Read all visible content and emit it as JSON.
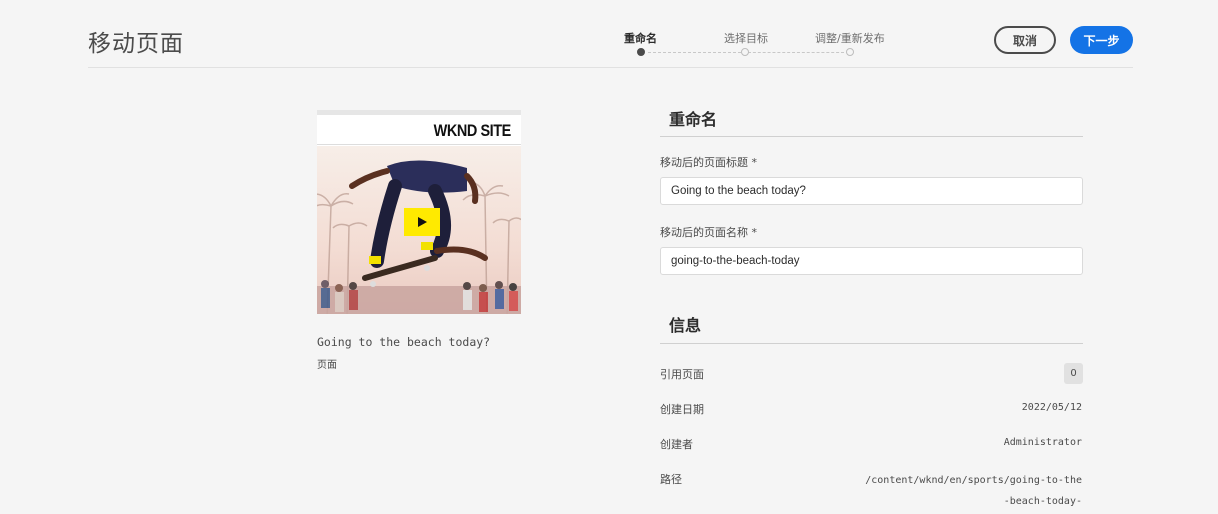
{
  "header": {
    "title": "移动页面",
    "steps": [
      {
        "label": "重命名",
        "active": true
      },
      {
        "label": "选择目标",
        "active": false
      },
      {
        "label": "调整/重新发布",
        "active": false
      }
    ],
    "cancel_label": "取消",
    "next_label": "下一步"
  },
  "card": {
    "logo_text": "WKND SITE",
    "title": "Going to the beach today?",
    "type": "页面"
  },
  "rename": {
    "heading": "重命名",
    "title_label": "移动后的页面标题 *",
    "title_value": "Going to the beach today?",
    "name_label": "移动后的页面名称 *",
    "name_value": "going-to-the-beach-today"
  },
  "info": {
    "heading": "信息",
    "references_label": "引用页面",
    "references_count": "0",
    "created_label": "创建日期",
    "created_value": "2022/05/12",
    "creator_label": "创建者",
    "creator_value": "Administrator",
    "path_label": "路径",
    "path_value": "/content/wknd/en/sports/going-to-the-beach-today-"
  },
  "colors": {
    "accent": "#1473e6",
    "background": "#f5f5f5",
    "play_button": "#ffea00"
  }
}
